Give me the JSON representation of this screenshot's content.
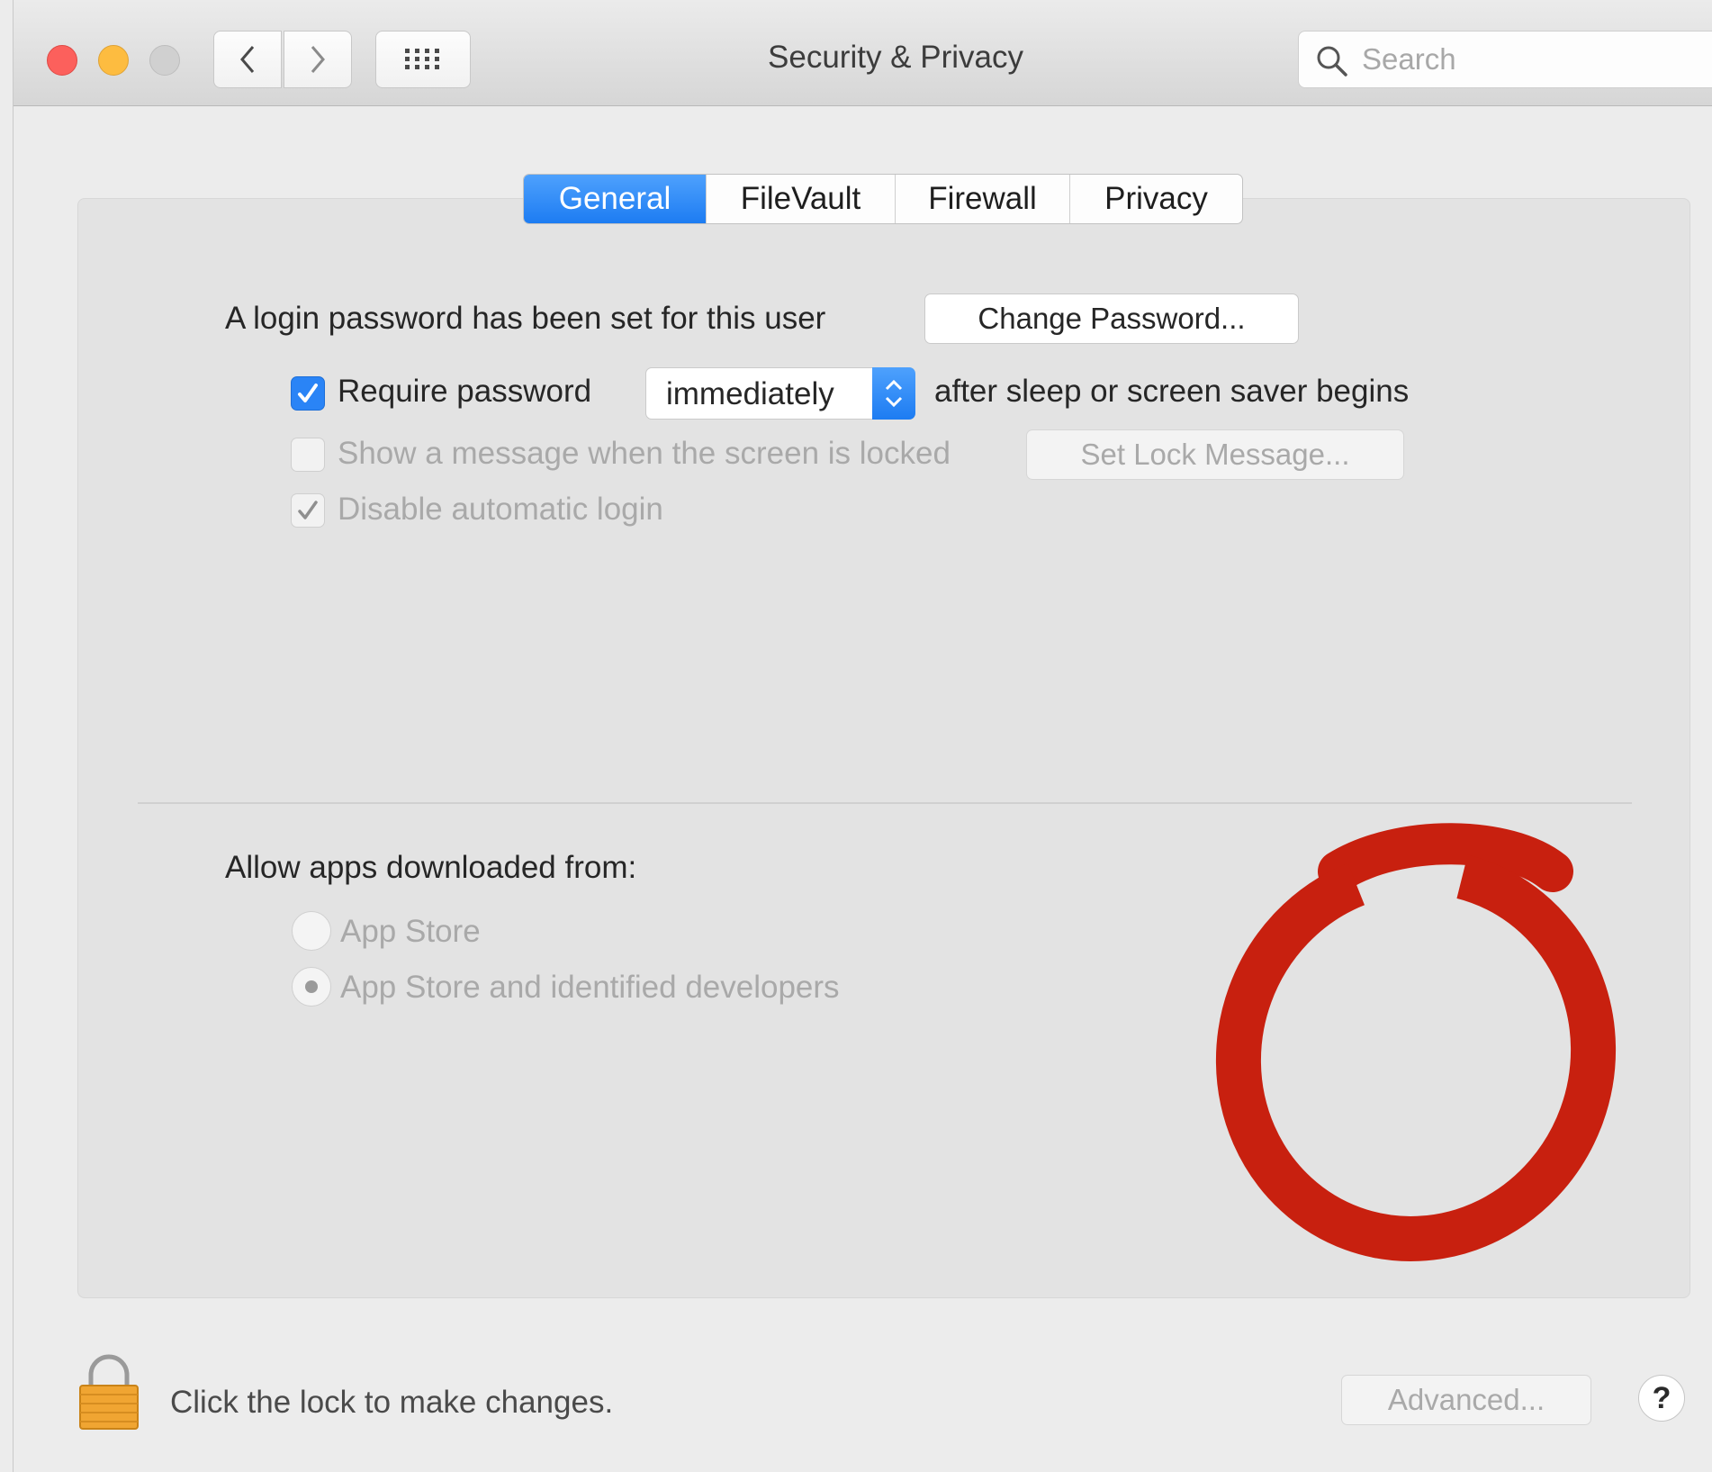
{
  "window": {
    "title": "Security & Privacy",
    "search_placeholder": "Search"
  },
  "toolbar": {
    "icons": [
      "chevron-left-icon",
      "chevron-right-icon",
      "grid-icon"
    ]
  },
  "tabs": [
    {
      "label": "General",
      "active": true
    },
    {
      "label": "FileVault",
      "active": false
    },
    {
      "label": "Firewall",
      "active": false
    },
    {
      "label": "Privacy",
      "active": false
    }
  ],
  "general": {
    "password_status": "A login password has been set for this user",
    "change_password_button": "Change Password...",
    "require_password": {
      "label": "Require password",
      "checked": true,
      "delay_value": "immediately",
      "suffix": "after sleep or screen saver begins"
    },
    "show_message": {
      "label": "Show a message when the screen is locked",
      "checked": false,
      "button": "Set Lock Message..."
    },
    "disable_auto_login": {
      "label": "Disable automatic login",
      "checked": true
    }
  },
  "gatekeeper": {
    "heading": "Allow apps downloaded from:",
    "options": [
      {
        "label": "App Store",
        "selected": false
      },
      {
        "label": "App Store and identified developers",
        "selected": true
      }
    ]
  },
  "footer": {
    "lock_text": "Click the lock to make changes.",
    "advanced_button": "Advanced...",
    "help_button": "?"
  },
  "colors": {
    "accent": "#1d7cf2",
    "close": "#fc605c",
    "minimize": "#fdbc40",
    "annotation": "#c8200f",
    "lock": "#f0a532"
  }
}
